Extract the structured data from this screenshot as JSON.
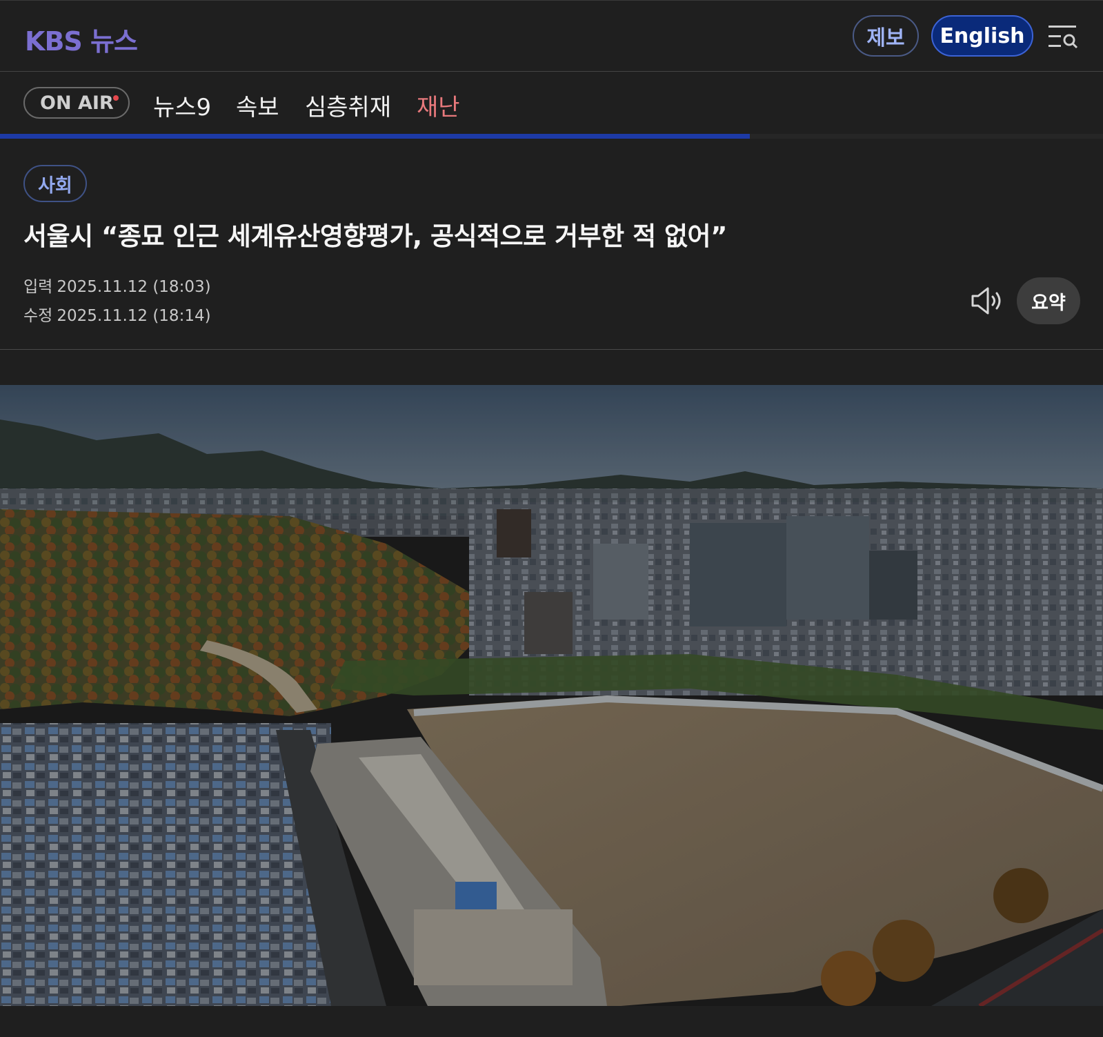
{
  "header": {
    "logo_text": "KBS 뉴스",
    "report_button": "제보",
    "english_button": "English",
    "menu_icon": "menu-search-icon"
  },
  "nav": {
    "onair_label": "ON AIR",
    "items": [
      "뉴스9",
      "속보",
      "심층취재",
      "재난"
    ],
    "alert_color": "#e8797c",
    "reading_progress": 0.68
  },
  "article": {
    "category": "사회",
    "headline": "서울시 “종묘 인근 세계유산영향평가, 공식적으로 거부한 적 없어”",
    "input_label": "입력",
    "input_date": "2025.11.12 (18:03)",
    "modified_label": "수정",
    "modified_date": "2025.11.12 (18:14)",
    "audio_icon": "speaker-icon",
    "summary_button": "요약"
  },
  "colors": {
    "background": "#1f1f1f",
    "logo": "#7b6fd1",
    "english_bg": "#0a2a7a",
    "progress": "#1d3aa6",
    "category_text": "#93a9ef"
  }
}
